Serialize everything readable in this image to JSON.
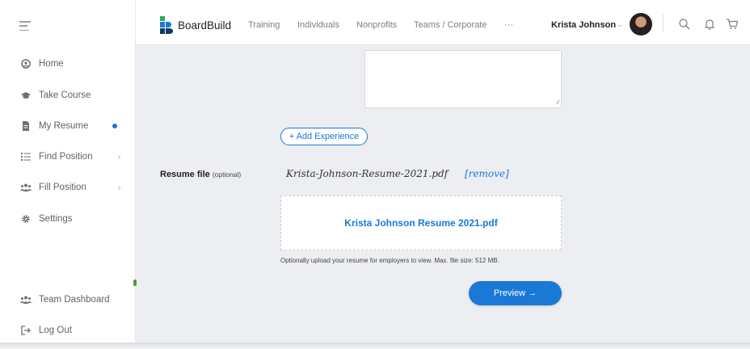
{
  "brand": {
    "name": "BoardBuild",
    "colors": {
      "accent": "#1a78d6",
      "logo_blue": "#1a78d6",
      "logo_green": "#27ae60",
      "logo_navy": "#0d3b66"
    }
  },
  "header": {
    "nav": [
      "Training",
      "Individuals",
      "Nonprofits",
      "Teams / Corporate",
      "···"
    ],
    "user_name": "Krista Johnson",
    "icons": [
      "search-icon",
      "bell-icon",
      "cart-icon"
    ]
  },
  "sidebar": {
    "items": [
      {
        "label": "Home",
        "icon": "home-icon"
      },
      {
        "label": "Take Course",
        "icon": "graduation-cap-icon"
      },
      {
        "label": "My Resume",
        "icon": "document-icon",
        "indicator": "dot"
      },
      {
        "label": "Find Position",
        "icon": "list-icon",
        "chevron": "›"
      },
      {
        "label": "Fill Position",
        "icon": "users-icon",
        "chevron": "›"
      },
      {
        "label": "Settings",
        "icon": "gear-icon"
      }
    ],
    "bottom_items": [
      {
        "label": "Team Dashboard",
        "icon": "users-icon"
      },
      {
        "label": "Log Out",
        "icon": "logout-icon"
      }
    ]
  },
  "main": {
    "add_experience_label": "+ Add Experience",
    "resume_file": {
      "label": "Resume file",
      "optional": "(optional)",
      "file_name": "Krista-Johnson-Resume-2021.pdf",
      "remove_label": "[remove]",
      "dropzone_text": "Krista Johnson Resume 2021.pdf",
      "help_text": "Optionally upload your resume for employers to view. Max. file size: 512 MB."
    },
    "preview_label": "Preview →"
  }
}
